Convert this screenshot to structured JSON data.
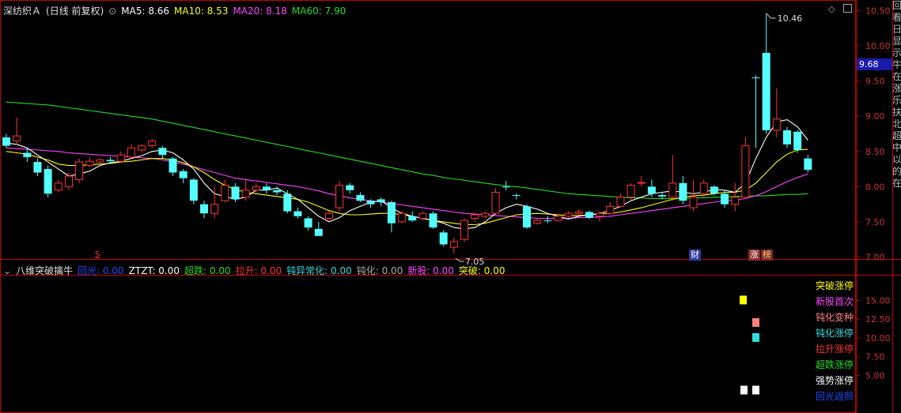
{
  "main_header": {
    "stock": "深纺织Ａ",
    "period": "(日线 前复权)",
    "ma5_label": "MA5: 8.66",
    "ma10_label": "MA10: 8.53",
    "ma20_label": "MA20: 8.18",
    "ma60_label": "MA60: 7.90"
  },
  "sub_header": {
    "name": "八维突破擒牛",
    "items": [
      {
        "label": "回光: 0.00",
        "color": "#1e4dff"
      },
      {
        "label": "ZTZT: 0.00",
        "color": "#ffffff"
      },
      {
        "label": "超跌: 0.00",
        "color": "#22dd22"
      },
      {
        "label": "拉升: 0.00",
        "color": "#ff3333"
      },
      {
        "label": "钝异常化: 0.00",
        "color": "#33dddd"
      },
      {
        "label": "钝化: 0.00",
        "color": "#aaaaaa"
      },
      {
        "label": "新股: 0.00",
        "color": "#ff44ff"
      },
      {
        "label": "突破: 0.00",
        "color": "#ffff00"
      }
    ]
  },
  "price_tag": "9.68",
  "markers": {
    "s_marker": "S",
    "cai_marker": "财",
    "zhang_marker": "涨",
    "bang_marker": "榜"
  },
  "colors": {
    "up": "#ff3333",
    "down": "#54ffff",
    "ma5": "#ffffff",
    "ma10": "#ffff00",
    "ma20": "#ff44ff",
    "ma60": "#22dd22",
    "frame": "#c00000"
  },
  "chart_data": {
    "type": "candlestick",
    "price_axis": {
      "range": [
        6.95,
        10.65
      ],
      "ticks": [
        "10.50",
        "10.00",
        "9.50",
        "9.00",
        "8.50",
        "8.00",
        "7.50",
        "7.00"
      ]
    },
    "annotations": {
      "high_label": "10.46",
      "low_label": "7.05"
    },
    "candles": [
      [
        8.7,
        8.58,
        8.75,
        8.55
      ],
      [
        8.65,
        8.72,
        8.98,
        8.6
      ],
      [
        8.48,
        8.42,
        8.55,
        8.35
      ],
      [
        8.35,
        8.2,
        8.4,
        8.15
      ],
      [
        8.25,
        7.9,
        8.3,
        7.85
      ],
      [
        7.95,
        8.05,
        8.1,
        7.92
      ],
      [
        8.0,
        8.15,
        8.2,
        7.95
      ],
      [
        8.1,
        8.35,
        8.4,
        8.05
      ],
      [
        8.3,
        8.36,
        8.42,
        8.28
      ],
      [
        8.35,
        8.38,
        8.4,
        8.32
      ],
      [
        8.38,
        8.36,
        8.42,
        8.33
      ],
      [
        8.36,
        8.45,
        8.5,
        8.35
      ],
      [
        8.42,
        8.55,
        8.6,
        8.4
      ],
      [
        8.52,
        8.58,
        8.6,
        8.48
      ],
      [
        8.58,
        8.65,
        8.68,
        8.55
      ],
      [
        8.55,
        8.45,
        8.58,
        8.4
      ],
      [
        8.4,
        8.2,
        8.42,
        8.15
      ],
      [
        8.22,
        8.12,
        8.25,
        8.05
      ],
      [
        8.1,
        7.8,
        8.12,
        7.75
      ],
      [
        7.75,
        7.62,
        7.8,
        7.55
      ],
      [
        7.62,
        7.75,
        8.0,
        7.55
      ],
      [
        7.8,
        8.02,
        8.1,
        7.78
      ],
      [
        8.0,
        7.82,
        8.05,
        7.78
      ],
      [
        7.85,
        7.95,
        8.1,
        7.8
      ],
      [
        7.95,
        8.0,
        8.05,
        7.92
      ],
      [
        8.0,
        7.95,
        8.05,
        7.9
      ],
      [
        7.95,
        7.92,
        8.0,
        7.88
      ],
      [
        7.9,
        7.65,
        7.95,
        7.62
      ],
      [
        7.65,
        7.58,
        7.7,
        7.55
      ],
      [
        7.55,
        7.42,
        7.58,
        7.38
      ],
      [
        7.4,
        7.3,
        7.5,
        7.3
      ],
      [
        7.55,
        7.62,
        7.65,
        7.52
      ],
      [
        7.7,
        8.02,
        8.08,
        7.65
      ],
      [
        8.02,
        7.95,
        8.05,
        7.9
      ],
      [
        7.88,
        7.8,
        7.92,
        7.78
      ],
      [
        7.8,
        7.75,
        7.82,
        7.7
      ],
      [
        7.82,
        7.78,
        7.85,
        7.72
      ],
      [
        7.78,
        7.48,
        7.8,
        7.35
      ],
      [
        7.5,
        7.62,
        7.65,
        7.48
      ],
      [
        7.58,
        7.52,
        7.65,
        7.5
      ],
      [
        7.55,
        7.62,
        7.65,
        7.52
      ],
      [
        7.62,
        7.42,
        7.65,
        7.4
      ],
      [
        7.35,
        7.18,
        7.38,
        7.15
      ],
      [
        7.14,
        7.22,
        7.28,
        7.05
      ],
      [
        7.25,
        7.52,
        7.55,
        7.22
      ],
      [
        7.55,
        7.6,
        7.62,
        7.5
      ],
      [
        7.58,
        7.62,
        7.65,
        7.55
      ],
      [
        7.62,
        7.92,
        7.98,
        7.6
      ],
      [
        8.0,
        7.99,
        8.08,
        7.95
      ],
      [
        7.88,
        7.87,
        7.9,
        7.82
      ],
      [
        7.72,
        7.42,
        7.75,
        7.4
      ],
      [
        7.48,
        7.52,
        7.55,
        7.46
      ],
      [
        7.52,
        7.51,
        7.58,
        7.48
      ],
      [
        7.52,
        7.58,
        7.62,
        7.5
      ],
      [
        7.58,
        7.62,
        7.65,
        7.56
      ],
      [
        7.62,
        7.64,
        7.68,
        7.58
      ],
      [
        7.64,
        7.56,
        7.66,
        7.54
      ],
      [
        7.58,
        7.62,
        7.65,
        7.5
      ],
      [
        7.62,
        7.72,
        7.78,
        7.6
      ],
      [
        7.72,
        7.85,
        7.9,
        7.7
      ],
      [
        7.85,
        8.02,
        8.05,
        7.8
      ],
      [
        8.05,
        8.06,
        8.15,
        8.0
      ],
      [
        8.0,
        7.9,
        8.1,
        7.85
      ],
      [
        7.88,
        7.86,
        7.92,
        7.82
      ],
      [
        7.85,
        8.05,
        8.45,
        7.8
      ],
      [
        8.05,
        7.8,
        8.15,
        7.75
      ],
      [
        7.7,
        7.85,
        8.1,
        7.65
      ],
      [
        7.9,
        8.05,
        8.1,
        7.85
      ],
      [
        8.0,
        7.9,
        8.02,
        7.88
      ],
      [
        7.9,
        7.75,
        7.95,
        7.7
      ],
      [
        7.75,
        7.85,
        8.05,
        7.65
      ],
      [
        7.85,
        8.58,
        8.7,
        7.85
      ],
      [
        9.55,
        9.54,
        9.58,
        8.55
      ],
      [
        9.9,
        8.8,
        10.46,
        8.75
      ],
      [
        8.8,
        8.96,
        9.4,
        8.7
      ],
      [
        8.8,
        8.6,
        8.85,
        8.55
      ],
      [
        8.78,
        8.52,
        8.8,
        8.48
      ],
      [
        8.4,
        8.24,
        8.45,
        8.2
      ]
    ],
    "ma5": [
      8.62,
      8.6,
      8.55,
      8.45,
      8.35,
      8.25,
      8.15,
      8.18,
      8.22,
      8.3,
      8.34,
      8.36,
      8.4,
      8.44,
      8.5,
      8.52,
      8.48,
      8.38,
      8.25,
      8.05,
      7.9,
      7.86,
      7.82,
      7.85,
      7.95,
      7.95,
      7.98,
      7.9,
      7.82,
      7.7,
      7.58,
      7.5,
      7.56,
      7.66,
      7.72,
      7.78,
      7.8,
      7.7,
      7.62,
      7.58,
      7.55,
      7.52,
      7.48,
      7.42,
      7.4,
      7.42,
      7.5,
      7.62,
      7.7,
      7.75,
      7.72,
      7.68,
      7.62,
      7.58,
      7.54,
      7.58,
      7.6,
      7.62,
      7.66,
      7.72,
      7.8,
      7.85,
      7.9,
      7.92,
      7.94,
      7.92,
      7.9,
      7.92,
      7.96,
      7.95,
      7.92,
      8.05,
      8.4,
      8.7,
      8.92,
      8.95,
      8.85,
      8.66
    ],
    "ma10": [
      8.5,
      8.48,
      8.46,
      8.42,
      8.38,
      8.32,
      8.3,
      8.3,
      8.31,
      8.32,
      8.33,
      8.35,
      8.36,
      8.38,
      8.4,
      8.4,
      8.38,
      8.34,
      8.28,
      8.2,
      8.1,
      8.02,
      7.96,
      7.92,
      7.9,
      7.88,
      7.86,
      7.84,
      7.82,
      7.78,
      7.72,
      7.66,
      7.62,
      7.6,
      7.6,
      7.61,
      7.62,
      7.62,
      7.6,
      7.58,
      7.55,
      7.52,
      7.5,
      7.48,
      7.46,
      7.46,
      7.48,
      7.52,
      7.56,
      7.6,
      7.61,
      7.62,
      7.61,
      7.6,
      7.59,
      7.59,
      7.6,
      7.61,
      7.62,
      7.64,
      7.67,
      7.7,
      7.74,
      7.78,
      7.82,
      7.85,
      7.87,
      7.88,
      7.9,
      7.92,
      7.92,
      7.95,
      8.05,
      8.2,
      8.35,
      8.46,
      8.52,
      8.53
    ],
    "ma20": [
      8.55,
      8.54,
      8.53,
      8.52,
      8.51,
      8.5,
      8.48,
      8.47,
      8.46,
      8.45,
      8.44,
      8.43,
      8.42,
      8.41,
      8.4,
      8.38,
      8.35,
      8.32,
      8.28,
      8.24,
      8.2,
      8.16,
      8.12,
      8.1,
      8.08,
      8.06,
      8.04,
      8.02,
      8.0,
      7.97,
      7.94,
      7.9,
      7.87,
      7.84,
      7.82,
      7.8,
      7.78,
      7.76,
      7.74,
      7.72,
      7.7,
      7.68,
      7.66,
      7.64,
      7.62,
      7.61,
      7.6,
      7.59,
      7.58,
      7.57,
      7.56,
      7.55,
      7.55,
      7.55,
      7.55,
      7.56,
      7.56,
      7.57,
      7.58,
      7.6,
      7.62,
      7.64,
      7.66,
      7.68,
      7.7,
      7.72,
      7.74,
      7.76,
      7.78,
      7.8,
      7.81,
      7.83,
      7.87,
      7.93,
      8.0,
      8.07,
      8.13,
      8.18
    ],
    "ma60": [
      9.2,
      9.19,
      9.18,
      9.17,
      9.16,
      9.14,
      9.12,
      9.1,
      9.08,
      9.06,
      9.04,
      9.02,
      9.0,
      8.98,
      8.96,
      8.93,
      8.9,
      8.87,
      8.84,
      8.81,
      8.78,
      8.75,
      8.72,
      8.69,
      8.66,
      8.63,
      8.6,
      8.57,
      8.54,
      8.51,
      8.48,
      8.45,
      8.42,
      8.39,
      8.36,
      8.33,
      8.3,
      8.27,
      8.24,
      8.21,
      8.18,
      8.16,
      8.13,
      8.11,
      8.09,
      8.07,
      8.05,
      8.03,
      8.01,
      8.0,
      7.98,
      7.96,
      7.94,
      7.92,
      7.9,
      7.89,
      7.88,
      7.87,
      7.86,
      7.85,
      7.84,
      7.84,
      7.83,
      7.83,
      7.83,
      7.83,
      7.84,
      7.84,
      7.85,
      7.85,
      7.86,
      7.86,
      7.87,
      7.87,
      7.88,
      7.89,
      7.89,
      7.9
    ]
  },
  "indicator_panel": {
    "axis_ticks": [
      "15.00",
      "12.50",
      "10.00",
      "7.50",
      "5.00"
    ],
    "legend": [
      {
        "label": "突破涨停",
        "color": "#ffff00"
      },
      {
        "label": "新股首次",
        "color": "#ff44ff"
      },
      {
        "label": "钝化变种",
        "color": "#ff8080"
      },
      {
        "label": "钝化涨停",
        "color": "#33dddd"
      },
      {
        "label": "拉升涨停",
        "color": "#ff3333"
      },
      {
        "label": "超跌涨停",
        "color": "#22dd22"
      },
      {
        "label": "强势涨停",
        "color": "#ffffff"
      },
      {
        "label": "回光返照",
        "color": "#1e4dff"
      }
    ],
    "signal_marks": [
      {
        "color": "#ffff00",
        "level": 15.0
      },
      {
        "color": "#ff8080",
        "level": 12.0
      },
      {
        "color": "#33dddd",
        "level": 10.0
      },
      {
        "color": "#ffffff",
        "level": 3.0
      },
      {
        "color": "#ffffff",
        "level": 3.0
      }
    ]
  },
  "right_strip_text": "回看 日 显 示 牛 在 涨 乐 扶 北 超 中 以 的 在"
}
